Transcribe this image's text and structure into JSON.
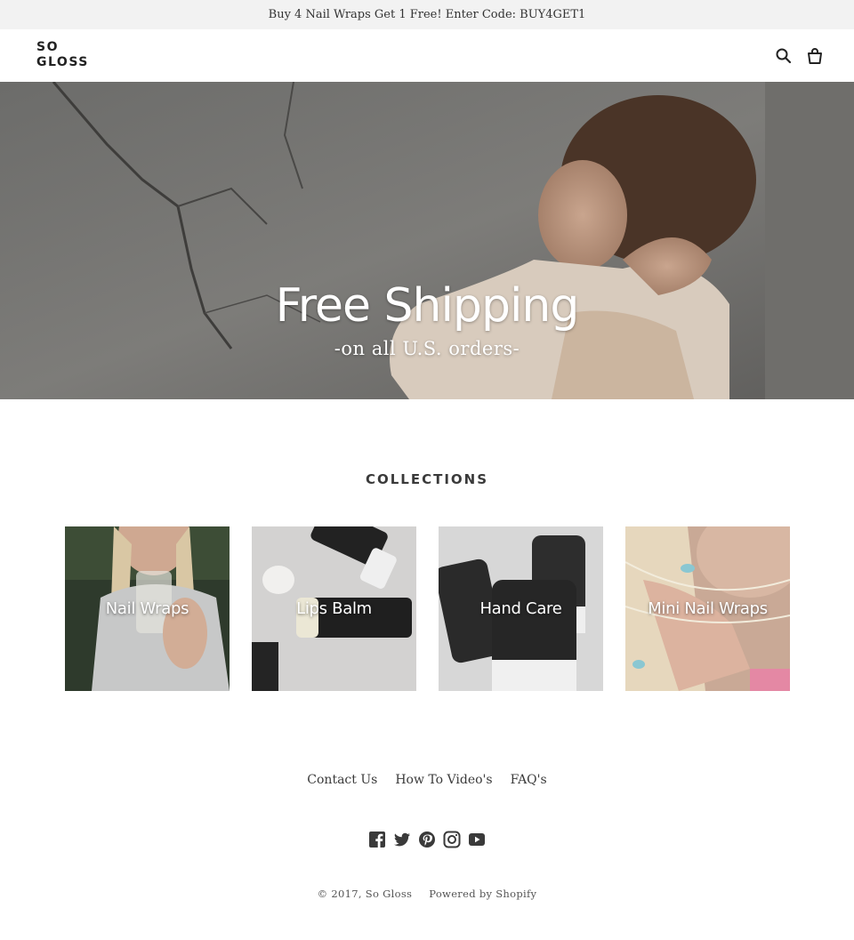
{
  "announcement": {
    "text": "Buy 4 Nail Wraps Get 1 Free! Enter Code: BUY4GET1"
  },
  "header": {
    "logo_line1": "SO",
    "logo_line2": "GLOSS",
    "icons": [
      "search-icon",
      "cart-icon"
    ]
  },
  "hero": {
    "title": "Free Shipping",
    "subtitle": "-on all U.S. orders-"
  },
  "collections": {
    "heading": "COLLECTIONS",
    "items": [
      {
        "label": "Nail Wraps"
      },
      {
        "label": "Lips Balm"
      },
      {
        "label": "Hand Care"
      },
      {
        "label": "Mini Nail Wraps"
      }
    ]
  },
  "footer": {
    "links": [
      "Contact Us",
      "How To Video's",
      "FAQ's"
    ],
    "social_icons": [
      "facebook-icon",
      "twitter-icon",
      "pinterest-icon",
      "instagram-icon",
      "youtube-icon"
    ],
    "copyright": "© 2017, So Gloss",
    "powered_by": "Powered by Shopify"
  },
  "colors": {
    "text": "#3a3a3a",
    "announcement_bg": "#f2f2f2",
    "white": "#ffffff"
  }
}
